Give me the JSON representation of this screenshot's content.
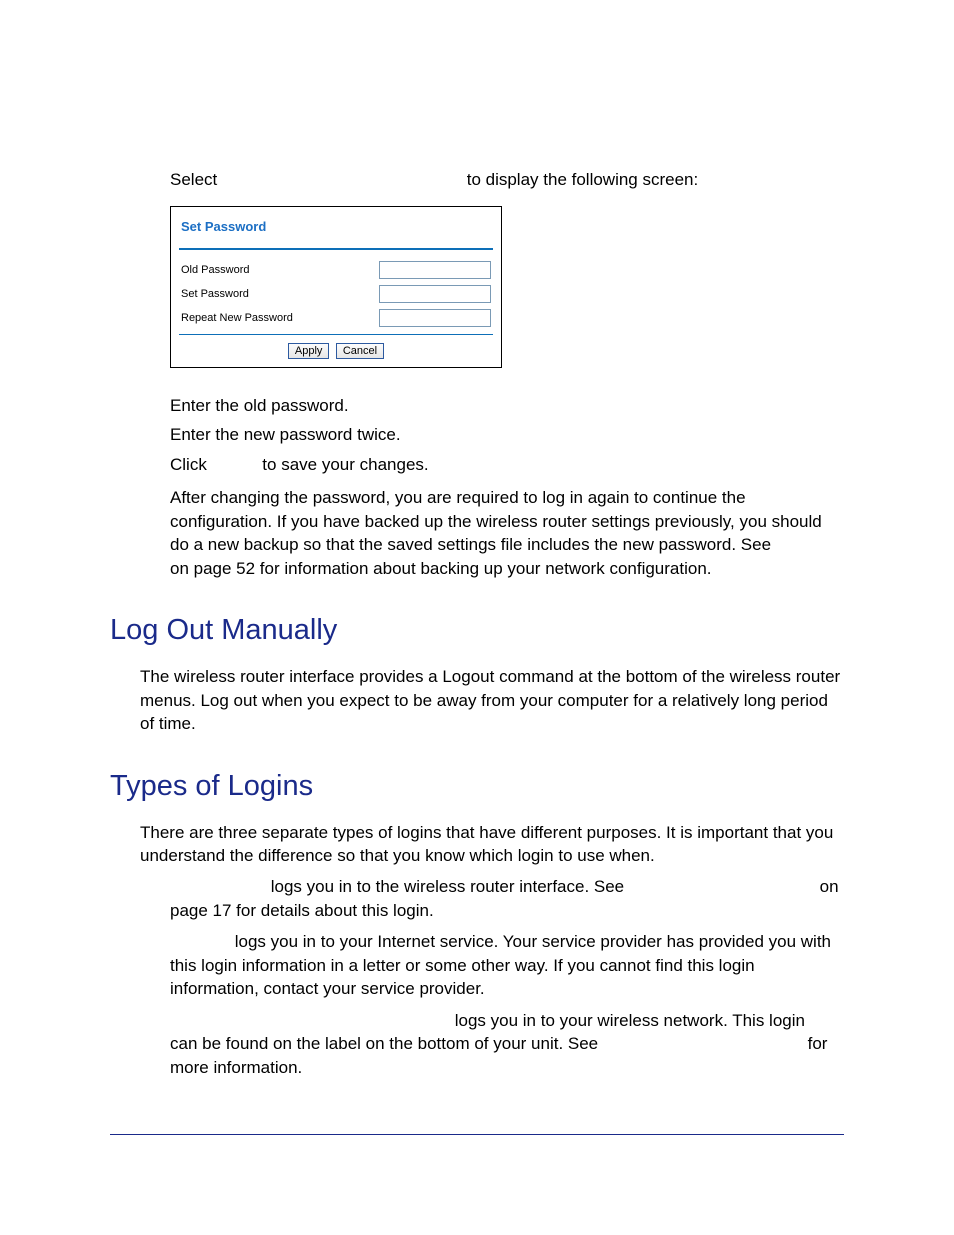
{
  "intro": {
    "before": "Select",
    "after": "to display the following screen:"
  },
  "panel": {
    "title": "Set Password",
    "fields": [
      {
        "label": "Old Password"
      },
      {
        "label": "Set Password"
      },
      {
        "label": "Repeat New Password"
      }
    ],
    "apply": "Apply",
    "cancel": "Cancel"
  },
  "steps": {
    "s1": "Enter the old password.",
    "s2": "Enter the new password twice.",
    "s3a": "Click ",
    "s3b": " to save your changes."
  },
  "after_change": "After changing the password, you are required to log in again to continue the configuration. If you have backed up the wireless router settings previously, you should do a new backup so that the saved settings file includes the new password. See",
  "after_change2": "on page 52 for information about backing up your network configuration.",
  "h_logout": "Log Out Manually",
  "logout_p": "The wireless router interface provides a Logout command at the bottom of the wireless router menus. Log out when you expect to be away from your computer for a relatively long period of time.",
  "h_types": "Types of Logins",
  "types_intro": "There are three separate types of logins that have different purposes. It is important that you understand the difference so that you know which login to use when.",
  "login1a": "logs you in to the wireless router interface. See",
  "login1b": "on",
  "login1c": "page 17 for details about this login.",
  "login2": "logs you in to your Internet service. Your service provider has provided you with this login information in a letter or some other way. If you cannot find this login information, contact your service provider.",
  "login3a": "logs you in to your wireless network. This login",
  "login3b": "can be found on the label on the bottom of your unit. See",
  "login3c": "for",
  "login3d": "more information."
}
